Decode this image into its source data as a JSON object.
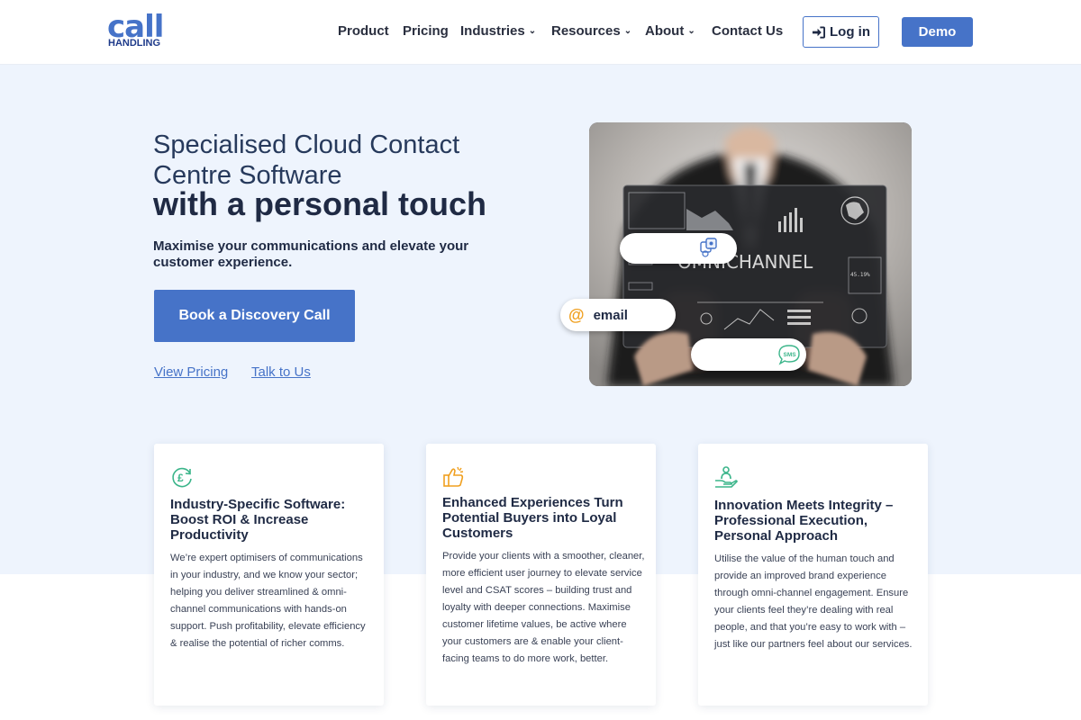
{
  "header": {
    "logo_top": "call",
    "logo_bottom": "HANDLING",
    "nav": [
      {
        "label": "Product",
        "dropdown": false
      },
      {
        "label": "Pricing",
        "dropdown": false
      },
      {
        "label": "Industries",
        "dropdown": true
      },
      {
        "label": "Resources",
        "dropdown": true
      },
      {
        "label": "About",
        "dropdown": true
      },
      {
        "label": "Contact Us",
        "dropdown": false
      }
    ],
    "login_label": "Log in",
    "demo_label": "Demo"
  },
  "hero": {
    "title_line1": "Specialised Cloud Contact Centre Software",
    "title_line2": "with a personal touch",
    "subtitle": "Maximise your communications and elevate your customer experience.",
    "cta_label": "Book a Discovery Call",
    "link_pricing": "View Pricing",
    "link_talk": "Talk to Us",
    "image": {
      "screen_text": "OMNICHANNEL",
      "email_label": "email",
      "sms_label": "SMS",
      "percent_label": "45.19%"
    }
  },
  "cards": [
    {
      "icon": "pound-refresh-icon",
      "title": "Industry-Specific Software: Boost ROI & Increase Productivity",
      "body": "We’re expert optimisers of communications in your industry, and we know your sector; helping you deliver streamlined & omni-channel communications with hands-on support. Push profitability, elevate efficiency & realise the potential of richer comms."
    },
    {
      "icon": "thumbs-up-icon",
      "title": "Enhanced Experiences Turn Potential Buyers into Loyal Customers",
      "body": "Provide your clients with a smoother, cleaner, more efficient user journey to elevate service level and CSAT scores – building trust and loyalty with deeper connections. Maximise customer lifetime values, be active where your customers are & enable your client-facing teams to do more work, better."
    },
    {
      "icon": "hand-person-icon",
      "title": "Innovation Meets Integrity – Professional Execution, Personal Approach",
      "body": "Utilise the value of the human touch and provide an improved brand experience through omni-channel engagement. Ensure your clients feel they’re dealing with real people, and that you’re easy to work with – just like our partners feel about our services."
    }
  ],
  "colors": {
    "brand_blue": "#4673c8",
    "hero_bg": "#eef4fd",
    "text_dark": "#1f2a44",
    "icon_green": "#3bb58a",
    "icon_orange": "#f0a020"
  }
}
